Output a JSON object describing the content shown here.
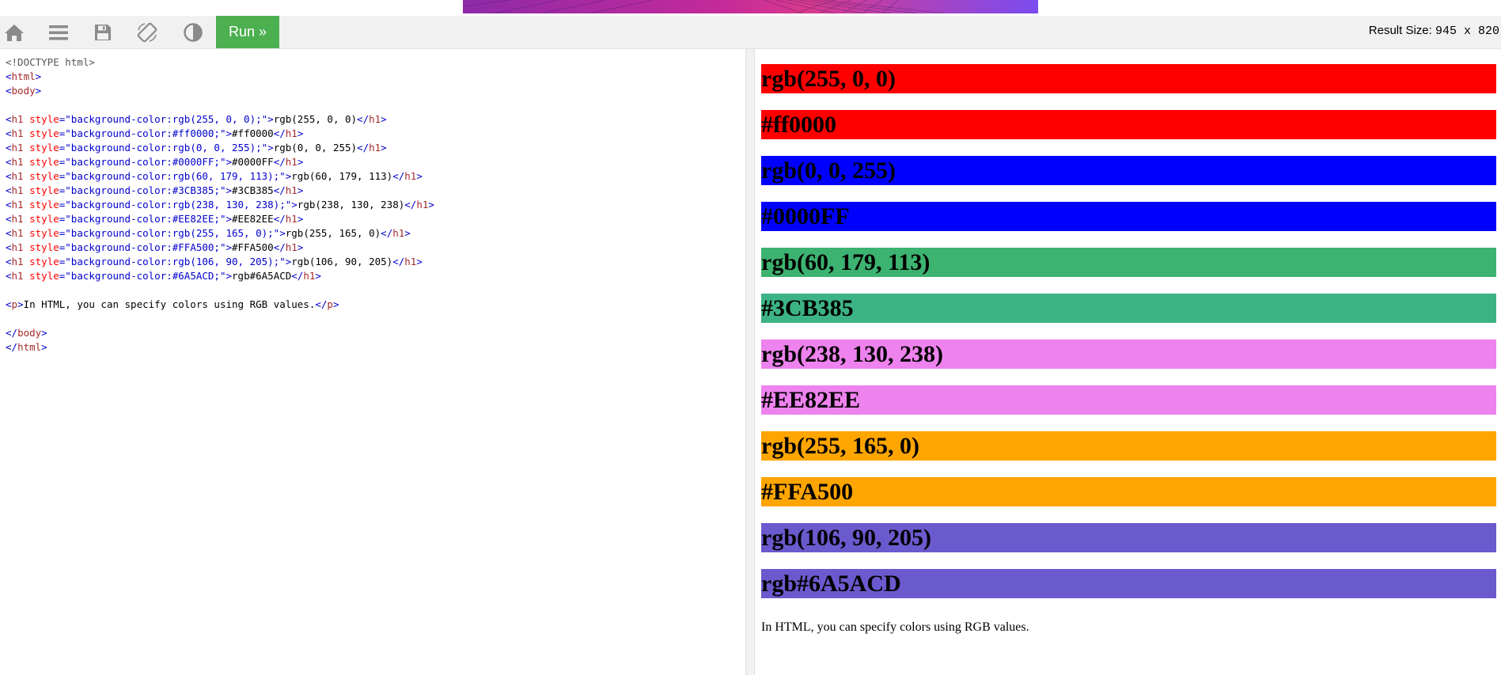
{
  "toolbar": {
    "icons": [
      "home-icon",
      "menu-icon",
      "save-icon",
      "rotate-icon",
      "contrast-icon"
    ],
    "run_label": "Run »",
    "result_size_label": "Result Size:",
    "result_size_value": "945 x 820"
  },
  "code": {
    "lines": [
      [
        {
          "t": "doc",
          "v": "<!DOCTYPE html>"
        }
      ],
      [
        {
          "t": "brk",
          "v": "<"
        },
        {
          "t": "tag",
          "v": "html"
        },
        {
          "t": "brk",
          "v": ">"
        }
      ],
      [
        {
          "t": "brk",
          "v": "<"
        },
        {
          "t": "tag",
          "v": "body"
        },
        {
          "t": "brk",
          "v": ">"
        }
      ],
      [],
      [
        {
          "t": "brk",
          "v": "<"
        },
        {
          "t": "tag",
          "v": "h1"
        },
        {
          "t": "attr",
          "v": " style"
        },
        {
          "t": "brk",
          "v": "="
        },
        {
          "t": "val",
          "v": "\"background-color:rgb(255, 0, 0);\""
        },
        {
          "t": "brk",
          "v": ">"
        },
        {
          "t": "txt",
          "v": "rgb(255, 0, 0)"
        },
        {
          "t": "brk",
          "v": "</"
        },
        {
          "t": "tag",
          "v": "h1"
        },
        {
          "t": "brk",
          "v": ">"
        }
      ],
      [
        {
          "t": "brk",
          "v": "<"
        },
        {
          "t": "tag",
          "v": "h1"
        },
        {
          "t": "attr",
          "v": " style"
        },
        {
          "t": "brk",
          "v": "="
        },
        {
          "t": "val",
          "v": "\"background-color:#ff0000;\""
        },
        {
          "t": "brk",
          "v": ">"
        },
        {
          "t": "txt",
          "v": "#ff0000"
        },
        {
          "t": "brk",
          "v": "</"
        },
        {
          "t": "tag",
          "v": "h1"
        },
        {
          "t": "brk",
          "v": ">"
        }
      ],
      [
        {
          "t": "brk",
          "v": "<"
        },
        {
          "t": "tag",
          "v": "h1"
        },
        {
          "t": "attr",
          "v": " style"
        },
        {
          "t": "brk",
          "v": "="
        },
        {
          "t": "val",
          "v": "\"background-color:rgb(0, 0, 255);\""
        },
        {
          "t": "brk",
          "v": ">"
        },
        {
          "t": "txt",
          "v": "rgb(0, 0, 255)"
        },
        {
          "t": "brk",
          "v": "</"
        },
        {
          "t": "tag",
          "v": "h1"
        },
        {
          "t": "brk",
          "v": ">"
        }
      ],
      [
        {
          "t": "brk",
          "v": "<"
        },
        {
          "t": "tag",
          "v": "h1"
        },
        {
          "t": "attr",
          "v": " style"
        },
        {
          "t": "brk",
          "v": "="
        },
        {
          "t": "val",
          "v": "\"background-color:#0000FF;\""
        },
        {
          "t": "brk",
          "v": ">"
        },
        {
          "t": "txt",
          "v": "#0000FF"
        },
        {
          "t": "brk",
          "v": "</"
        },
        {
          "t": "tag",
          "v": "h1"
        },
        {
          "t": "brk",
          "v": ">"
        }
      ],
      [
        {
          "t": "brk",
          "v": "<"
        },
        {
          "t": "tag",
          "v": "h1"
        },
        {
          "t": "attr",
          "v": " style"
        },
        {
          "t": "brk",
          "v": "="
        },
        {
          "t": "val",
          "v": "\"background-color:rgb(60, 179, 113);\""
        },
        {
          "t": "brk",
          "v": ">"
        },
        {
          "t": "txt",
          "v": "rgb(60, 179, 113)"
        },
        {
          "t": "brk",
          "v": "</"
        },
        {
          "t": "tag",
          "v": "h1"
        },
        {
          "t": "brk",
          "v": ">"
        }
      ],
      [
        {
          "t": "brk",
          "v": "<"
        },
        {
          "t": "tag",
          "v": "h1"
        },
        {
          "t": "attr",
          "v": " style"
        },
        {
          "t": "brk",
          "v": "="
        },
        {
          "t": "val",
          "v": "\"background-color:#3CB385;\""
        },
        {
          "t": "brk",
          "v": ">"
        },
        {
          "t": "txt",
          "v": "#3CB385"
        },
        {
          "t": "brk",
          "v": "</"
        },
        {
          "t": "tag",
          "v": "h1"
        },
        {
          "t": "brk",
          "v": ">"
        }
      ],
      [
        {
          "t": "brk",
          "v": "<"
        },
        {
          "t": "tag",
          "v": "h1"
        },
        {
          "t": "attr",
          "v": " style"
        },
        {
          "t": "brk",
          "v": "="
        },
        {
          "t": "val",
          "v": "\"background-color:rgb(238, 130, 238);\""
        },
        {
          "t": "brk",
          "v": ">"
        },
        {
          "t": "txt",
          "v": "rgb(238, 130, 238)"
        },
        {
          "t": "brk",
          "v": "</"
        },
        {
          "t": "tag",
          "v": "h1"
        },
        {
          "t": "brk",
          "v": ">"
        }
      ],
      [
        {
          "t": "brk",
          "v": "<"
        },
        {
          "t": "tag",
          "v": "h1"
        },
        {
          "t": "attr",
          "v": " style"
        },
        {
          "t": "brk",
          "v": "="
        },
        {
          "t": "val",
          "v": "\"background-color:#EE82EE;\""
        },
        {
          "t": "brk",
          "v": ">"
        },
        {
          "t": "txt",
          "v": "#EE82EE"
        },
        {
          "t": "brk",
          "v": "</"
        },
        {
          "t": "tag",
          "v": "h1"
        },
        {
          "t": "brk",
          "v": ">"
        }
      ],
      [
        {
          "t": "brk",
          "v": "<"
        },
        {
          "t": "tag",
          "v": "h1"
        },
        {
          "t": "attr",
          "v": " style"
        },
        {
          "t": "brk",
          "v": "="
        },
        {
          "t": "val",
          "v": "\"background-color:rgb(255, 165, 0);\""
        },
        {
          "t": "brk",
          "v": ">"
        },
        {
          "t": "txt",
          "v": "rgb(255, 165, 0)"
        },
        {
          "t": "brk",
          "v": "</"
        },
        {
          "t": "tag",
          "v": "h1"
        },
        {
          "t": "brk",
          "v": ">"
        }
      ],
      [
        {
          "t": "brk",
          "v": "<"
        },
        {
          "t": "tag",
          "v": "h1"
        },
        {
          "t": "attr",
          "v": " style"
        },
        {
          "t": "brk",
          "v": "="
        },
        {
          "t": "val",
          "v": "\"background-color:#FFA500;\""
        },
        {
          "t": "brk",
          "v": ">"
        },
        {
          "t": "txt",
          "v": "#FFA500"
        },
        {
          "t": "brk",
          "v": "</"
        },
        {
          "t": "tag",
          "v": "h1"
        },
        {
          "t": "brk",
          "v": ">"
        }
      ],
      [
        {
          "t": "brk",
          "v": "<"
        },
        {
          "t": "tag",
          "v": "h1"
        },
        {
          "t": "attr",
          "v": " style"
        },
        {
          "t": "brk",
          "v": "="
        },
        {
          "t": "val",
          "v": "\"background-color:rgb(106, 90, 205);\""
        },
        {
          "t": "brk",
          "v": ">"
        },
        {
          "t": "txt",
          "v": "rgb(106, 90, 205)"
        },
        {
          "t": "brk",
          "v": "</"
        },
        {
          "t": "tag",
          "v": "h1"
        },
        {
          "t": "brk",
          "v": ">"
        }
      ],
      [
        {
          "t": "brk",
          "v": "<"
        },
        {
          "t": "tag",
          "v": "h1"
        },
        {
          "t": "attr",
          "v": " style"
        },
        {
          "t": "brk",
          "v": "="
        },
        {
          "t": "val",
          "v": "\"background-color:#6A5ACD;\""
        },
        {
          "t": "brk",
          "v": ">"
        },
        {
          "t": "txt",
          "v": "rgb#6A5ACD"
        },
        {
          "t": "brk",
          "v": "</"
        },
        {
          "t": "tag",
          "v": "h1"
        },
        {
          "t": "brk",
          "v": ">"
        }
      ],
      [],
      [
        {
          "t": "brk",
          "v": "<"
        },
        {
          "t": "tag",
          "v": "p"
        },
        {
          "t": "brk",
          "v": ">"
        },
        {
          "t": "txt",
          "v": "In HTML, you can specify colors using RGB values."
        },
        {
          "t": "brk",
          "v": "</"
        },
        {
          "t": "tag",
          "v": "p"
        },
        {
          "t": "brk",
          "v": ">"
        }
      ],
      [],
      [
        {
          "t": "brk",
          "v": "</"
        },
        {
          "t": "tag",
          "v": "body"
        },
        {
          "t": "brk",
          "v": ">"
        }
      ],
      [
        {
          "t": "brk",
          "v": "</"
        },
        {
          "t": "tag",
          "v": "html"
        },
        {
          "t": "brk",
          "v": ">"
        }
      ]
    ]
  },
  "result": {
    "headings": [
      {
        "text": "rgb(255, 0, 0)",
        "color": "#ff0000"
      },
      {
        "text": "#ff0000",
        "color": "#ff0000"
      },
      {
        "text": "rgb(0, 0, 255)",
        "color": "#0000ff"
      },
      {
        "text": "#0000FF",
        "color": "#0000ff"
      },
      {
        "text": "rgb(60, 179, 113)",
        "color": "#3cb371"
      },
      {
        "text": "#3CB385",
        "color": "#3cb385"
      },
      {
        "text": "rgb(238, 130, 238)",
        "color": "#ee82ee"
      },
      {
        "text": "#EE82EE",
        "color": "#ee82ee"
      },
      {
        "text": "rgb(255, 165, 0)",
        "color": "#ffa500"
      },
      {
        "text": "#FFA500",
        "color": "#ffa500"
      },
      {
        "text": "rgb(106, 90, 205)",
        "color": "#6a5acd"
      },
      {
        "text": "rgb#6A5ACD",
        "color": "#6a5acd"
      }
    ],
    "paragraph": "In HTML, you can specify colors using RGB values."
  }
}
